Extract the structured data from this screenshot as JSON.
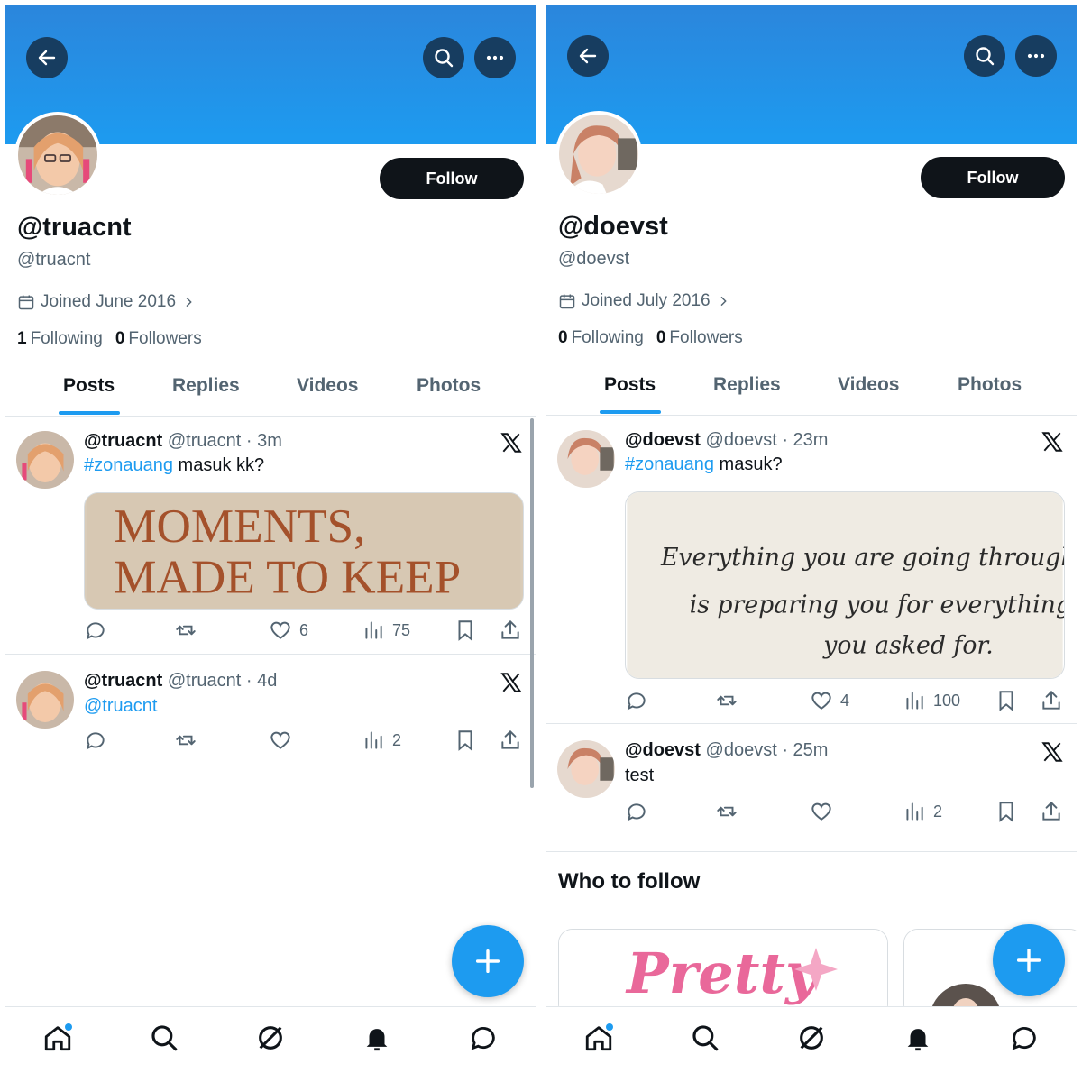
{
  "profiles": [
    {
      "display_name": "@truacnt",
      "handle": "@truacnt",
      "joined": "Joined June 2016",
      "following_count": "1",
      "following_label": "Following",
      "followers_count": "0",
      "followers_label": "Followers",
      "follow_label": "Follow",
      "tabs": [
        "Posts",
        "Replies",
        "Videos",
        "Photos"
      ],
      "posts": [
        {
          "username": "@truacnt",
          "meta": "@truacnt · 3m",
          "hashtag": "#zonauang",
          "text": " masuk kk?",
          "image_lines": [
            "MOMENTS,",
            "MADE TO KEEP"
          ],
          "likes": "6",
          "views": "75"
        },
        {
          "username": "@truacnt",
          "meta": "@truacnt · 4d",
          "mention": "@truacnt",
          "likes": "",
          "views": "2"
        }
      ]
    },
    {
      "display_name": "@doevst",
      "handle": "@doevst",
      "joined": "Joined July 2016",
      "following_count": "0",
      "following_label": "Following",
      "followers_count": "0",
      "followers_label": "Followers",
      "follow_label": "Follow",
      "tabs": [
        "Posts",
        "Replies",
        "Videos",
        "Photos"
      ],
      "posts": [
        {
          "username": "@doevst",
          "meta": "@doevst · 23m",
          "hashtag": "#zonauang",
          "text": " masuk?",
          "image_lines": [
            "Everything you are going through",
            "is preparing you for everything",
            "you asked for."
          ],
          "likes": "4",
          "views": "100"
        },
        {
          "username": "@doevst",
          "meta": "@doevst · 25m",
          "text": "test",
          "likes": "",
          "views": "2"
        }
      ],
      "who_to_follow": "Who to follow",
      "card_text": "Pretty"
    }
  ],
  "colors": {
    "accent": "#1d9bf0",
    "banner": "#2b86dc",
    "text": "#0f1419",
    "muted": "#536471"
  },
  "icons": {
    "back": "arrow-left-icon",
    "search": "search-icon",
    "more": "more-icon",
    "reply": "reply-icon",
    "repost": "repost-icon",
    "like": "heart-icon",
    "views": "views-icon",
    "bookmark": "bookmark-icon",
    "share": "share-icon",
    "compose": "plus-icon",
    "nav": [
      "home-icon",
      "search-icon",
      "grok-icon",
      "bell-icon",
      "messages-icon"
    ]
  }
}
